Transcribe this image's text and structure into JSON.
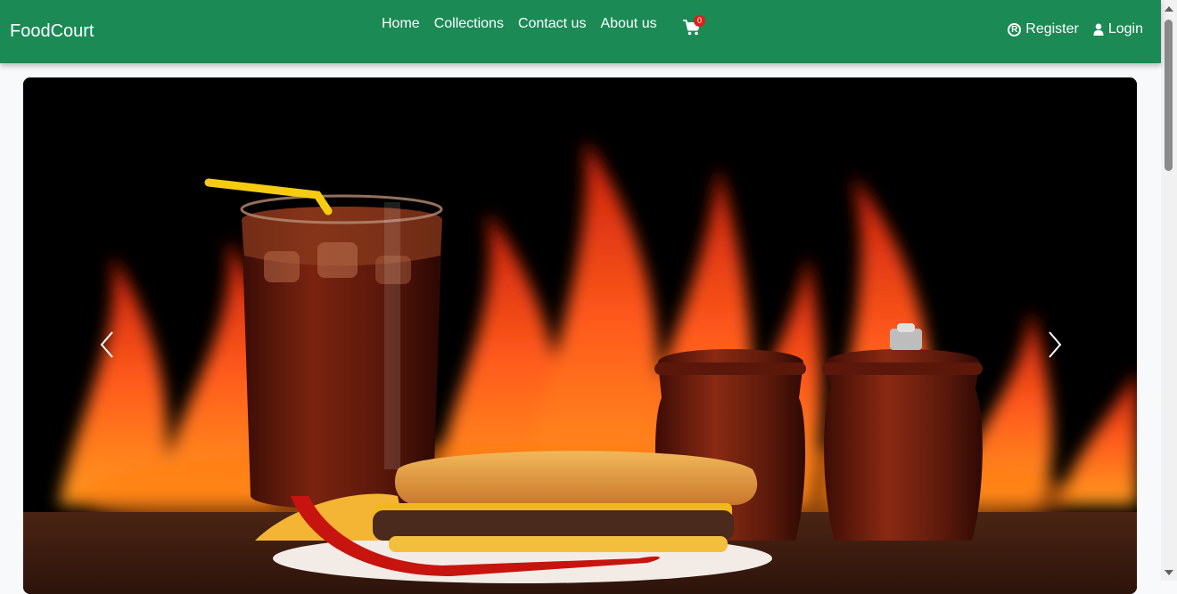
{
  "nav": {
    "brand": "FoodCourt",
    "links": [
      {
        "label": "Home"
      },
      {
        "label": "Collections"
      },
      {
        "label": "Contact us"
      },
      {
        "label": "About us"
      }
    ],
    "cart": {
      "icon": "shopping-cart-icon",
      "count": "0"
    },
    "register_label": "Register",
    "register_icon": "registered-icon",
    "login_label": "Login",
    "login_icon": "user-icon"
  },
  "hero": {
    "image": "burger-fries-cola-fire-photo",
    "prev_icon": "chevron-left-icon",
    "next_icon": "chevron-right-icon"
  },
  "colors": {
    "navbar": "#1b8a55",
    "badge": "#d9231b",
    "page_bg": "#f8f9fb"
  }
}
